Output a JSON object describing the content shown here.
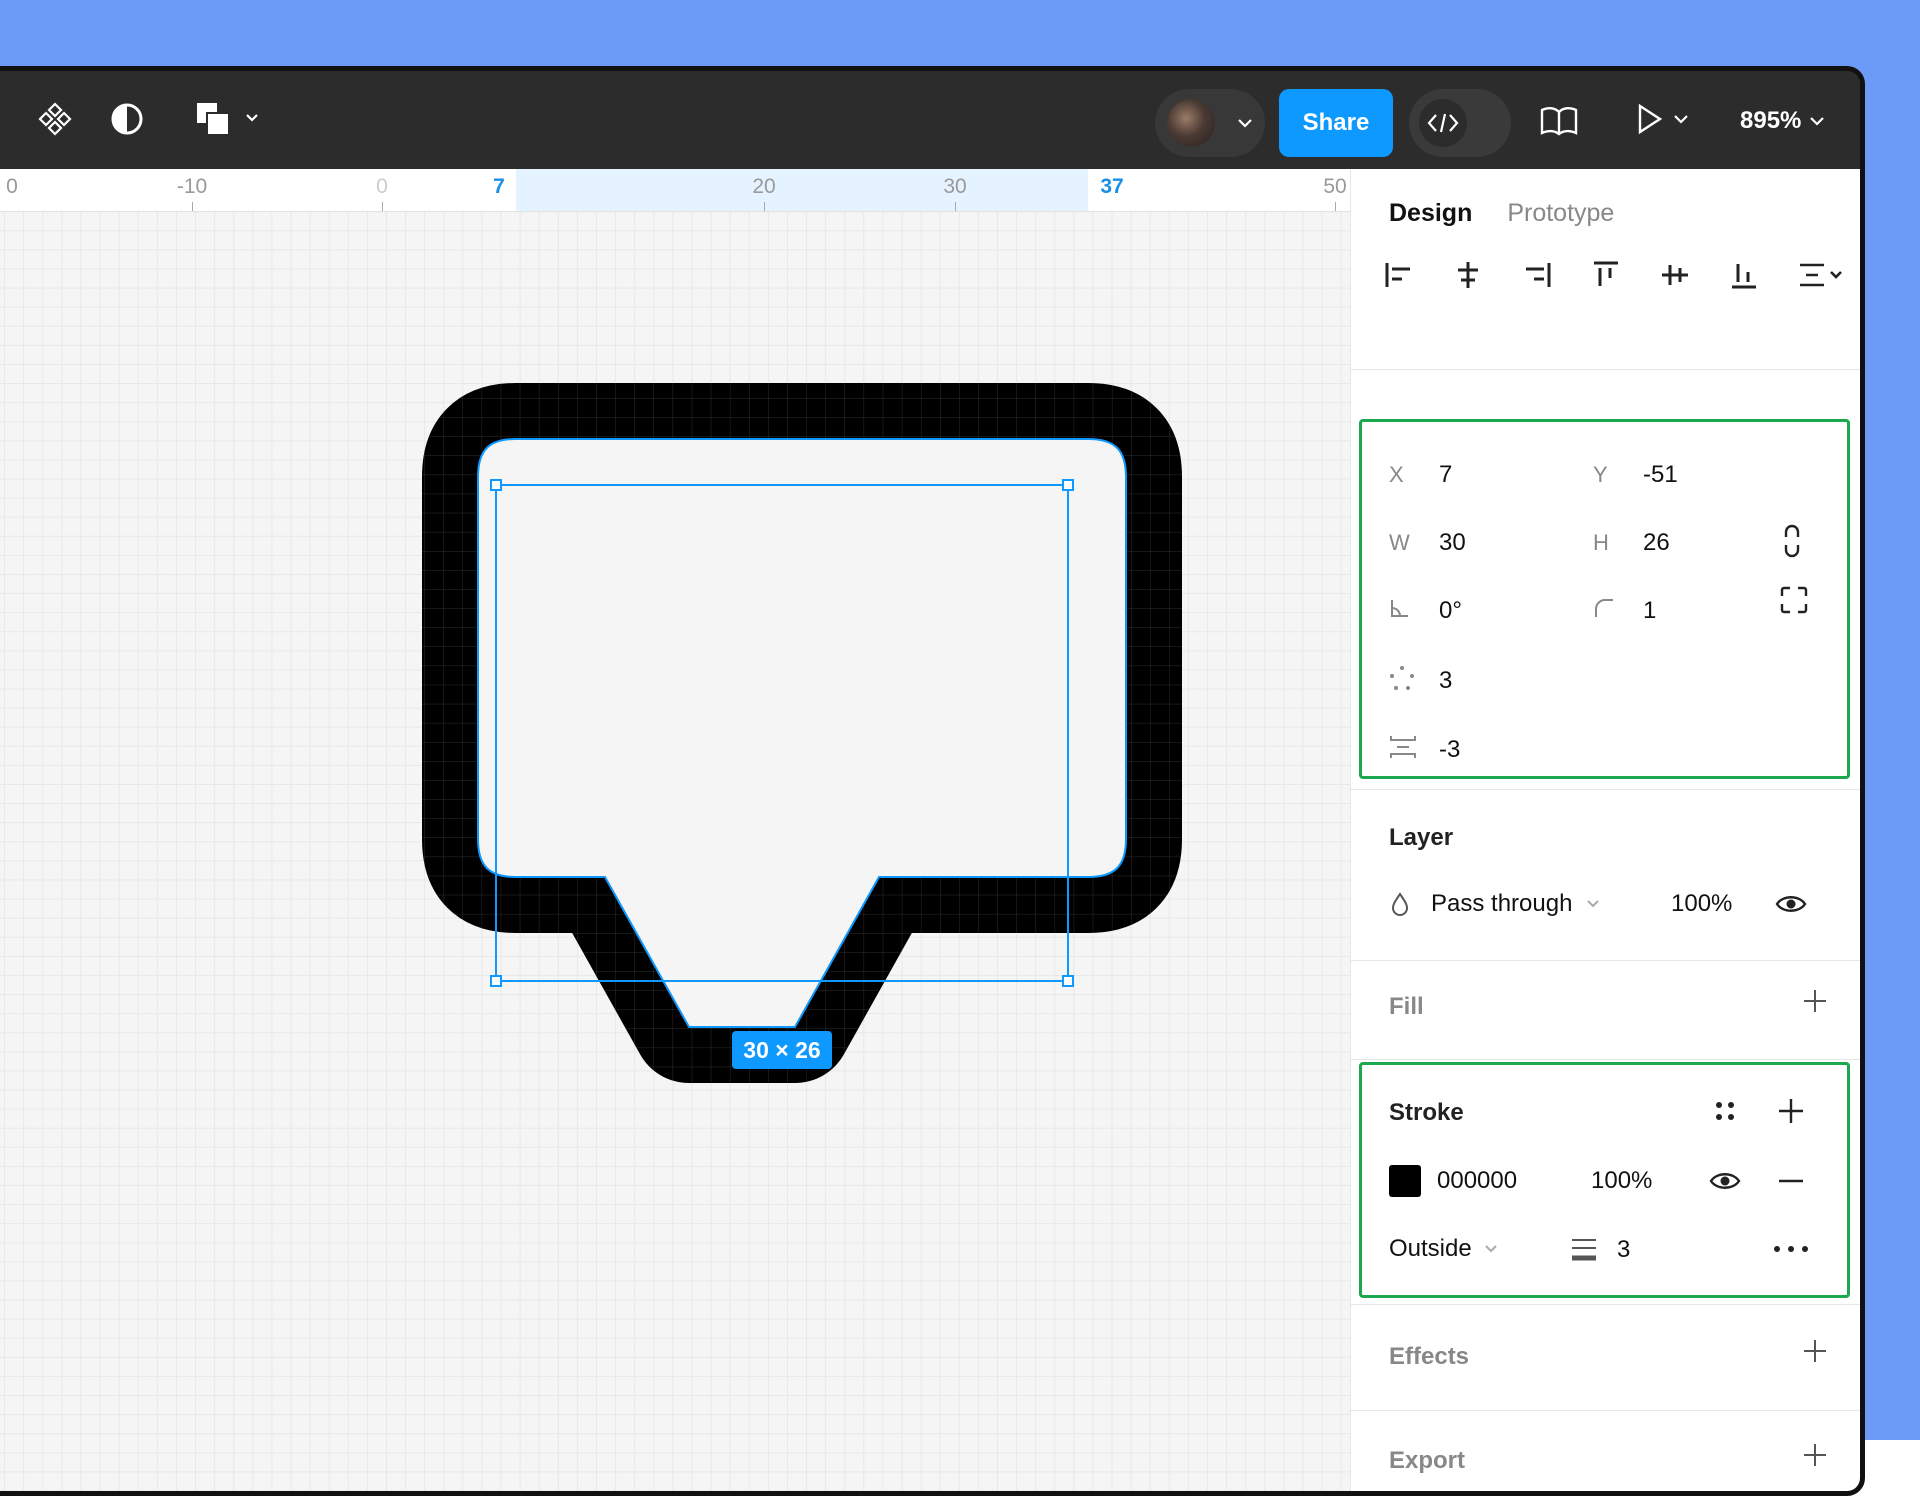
{
  "toolbar": {
    "share_label": "Share",
    "zoom_label": "895%"
  },
  "ruler": {
    "ticks": [
      "0",
      "-10",
      "0",
      "7",
      "20",
      "30",
      "37",
      "50"
    ]
  },
  "canvas": {
    "dimension_label": "30 × 26"
  },
  "panel": {
    "tabs": [
      "Design",
      "Prototype"
    ],
    "position": {
      "x_label": "X",
      "x_value": "7",
      "y_label": "Y",
      "y_value": "-51",
      "w_label": "W",
      "w_value": "30",
      "h_label": "H",
      "h_value": "26",
      "rotation_value": "0°",
      "radius_value": "1",
      "points_value": "3",
      "spacing_value": "-3"
    },
    "layer": {
      "title": "Layer",
      "blend_mode": "Pass through",
      "opacity": "100%"
    },
    "fill": {
      "title": "Fill"
    },
    "stroke": {
      "title": "Stroke",
      "color_hex": "000000",
      "swatch_color": "#000000",
      "opacity": "100%",
      "position": "Outside",
      "weight": "3"
    },
    "effects": {
      "title": "Effects"
    },
    "export": {
      "title": "Export"
    }
  }
}
